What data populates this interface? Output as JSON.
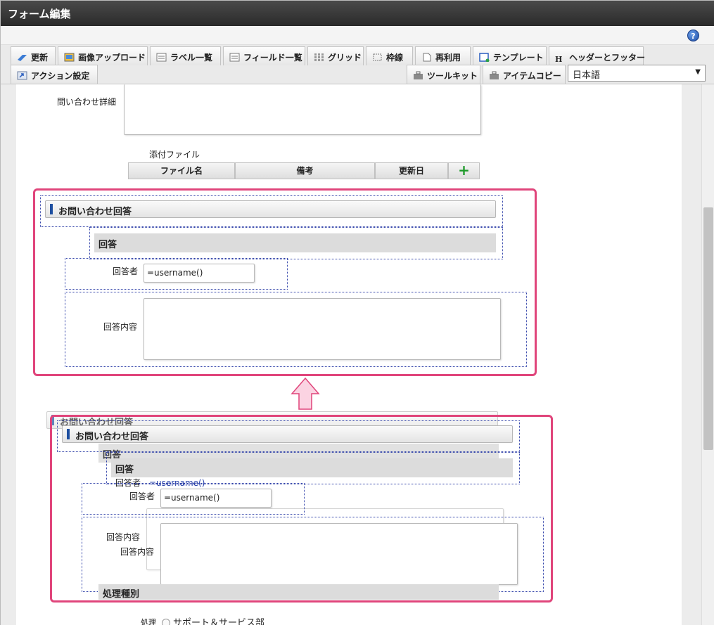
{
  "window": {
    "title": "フォーム編集",
    "help_icon": "?"
  },
  "toolbar": {
    "row1": [
      {
        "name": "update",
        "label": "更新"
      },
      {
        "name": "image-upload",
        "label": "画像アップロード"
      },
      {
        "name": "label-list",
        "label": "ラベル一覧"
      },
      {
        "name": "field-list",
        "label": "フィールド一覧"
      },
      {
        "name": "grid",
        "label": "グリッド"
      },
      {
        "name": "border",
        "label": "枠線"
      },
      {
        "name": "reuse",
        "label": "再利用"
      },
      {
        "name": "template",
        "label": "テンプレート"
      },
      {
        "name": "header-footer",
        "label": "ヘッダーとフッター"
      }
    ],
    "row2_left": {
      "name": "action-settings",
      "label": "アクション設定"
    },
    "row2_right": [
      {
        "name": "toolkit",
        "label": "ツールキット"
      },
      {
        "name": "item-copy",
        "label": "アイテムコピー"
      }
    ],
    "language": {
      "value": "日本語",
      "arrow": "▼"
    }
  },
  "form": {
    "inquiry_detail_label": "問い合わせ詳細",
    "attachment_label": "添付ファイル",
    "attachment_columns": [
      "ファイル名",
      "備考",
      "更新日"
    ],
    "add_icon": "+",
    "answer_section_title": "お問い合わせ回答",
    "answer_subtitle": "回答",
    "responder_label": "回答者",
    "responder_value": "=username()",
    "answer_content_label": "回答内容",
    "process_type_label": "処理種別",
    "process_label": "処理",
    "radio_option": "サポート＆サービス部"
  },
  "colors": {
    "highlight": "#e0457b",
    "accent": "#1e4fa0",
    "add": "#1e9a2a"
  }
}
